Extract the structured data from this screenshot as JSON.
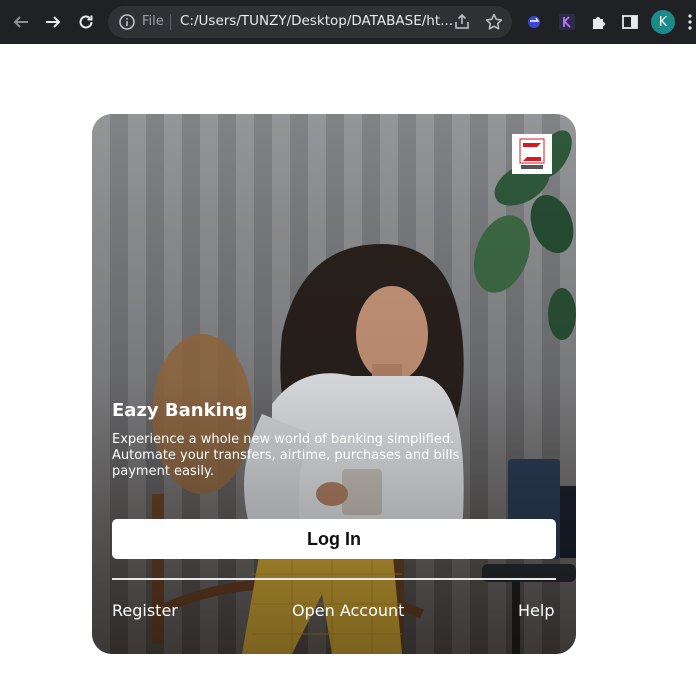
{
  "browser": {
    "url_prefix": "File",
    "url": "C:/Users/TUNZY/Desktop/DATABASE/ht...",
    "profile_initial": "K",
    "icons": [
      "back-arrow-icon",
      "forward-arrow-icon",
      "reload-icon",
      "info-icon",
      "share-icon",
      "star-icon",
      "extension-icon",
      "puzzle-icon",
      "side-panel-icon",
      "kebab-menu-icon"
    ]
  },
  "card": {
    "logo_alt": "ZENITH",
    "headline": "Eazy Banking",
    "description": "Experience a whole new world of banking simplified. Automate your transfers, airtime, purchases and bills payment easily.",
    "login_label": "Log In",
    "footer": {
      "register": "Register",
      "open_account": "Open Account",
      "help": "Help"
    }
  },
  "colors": {
    "chrome_bg": "#202124",
    "omnibox_bg": "#303134",
    "brand_red": "#d71920",
    "button_bg": "#ffffff",
    "text_light": "#ffffff"
  }
}
